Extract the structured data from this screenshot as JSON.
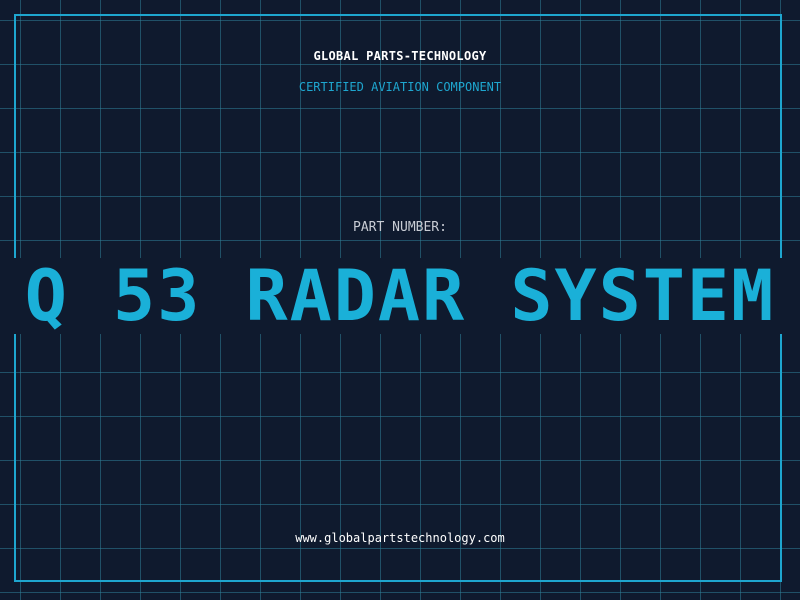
{
  "header": {
    "company_name": "GLOBAL PARTS-TECHNOLOGY",
    "certification": "CERTIFIED AVIATION COMPONENT"
  },
  "part": {
    "label": "PART NUMBER:",
    "number": "Q 53 RADAR SYSTEM"
  },
  "footer": {
    "website": "www.globalpartstechnology.com"
  },
  "colors": {
    "background": "#0f1a2e",
    "grid": "#2e7d96",
    "accent": "#1ab0d8",
    "text": "#ffffff",
    "muted_text": "#c8ccd4"
  }
}
